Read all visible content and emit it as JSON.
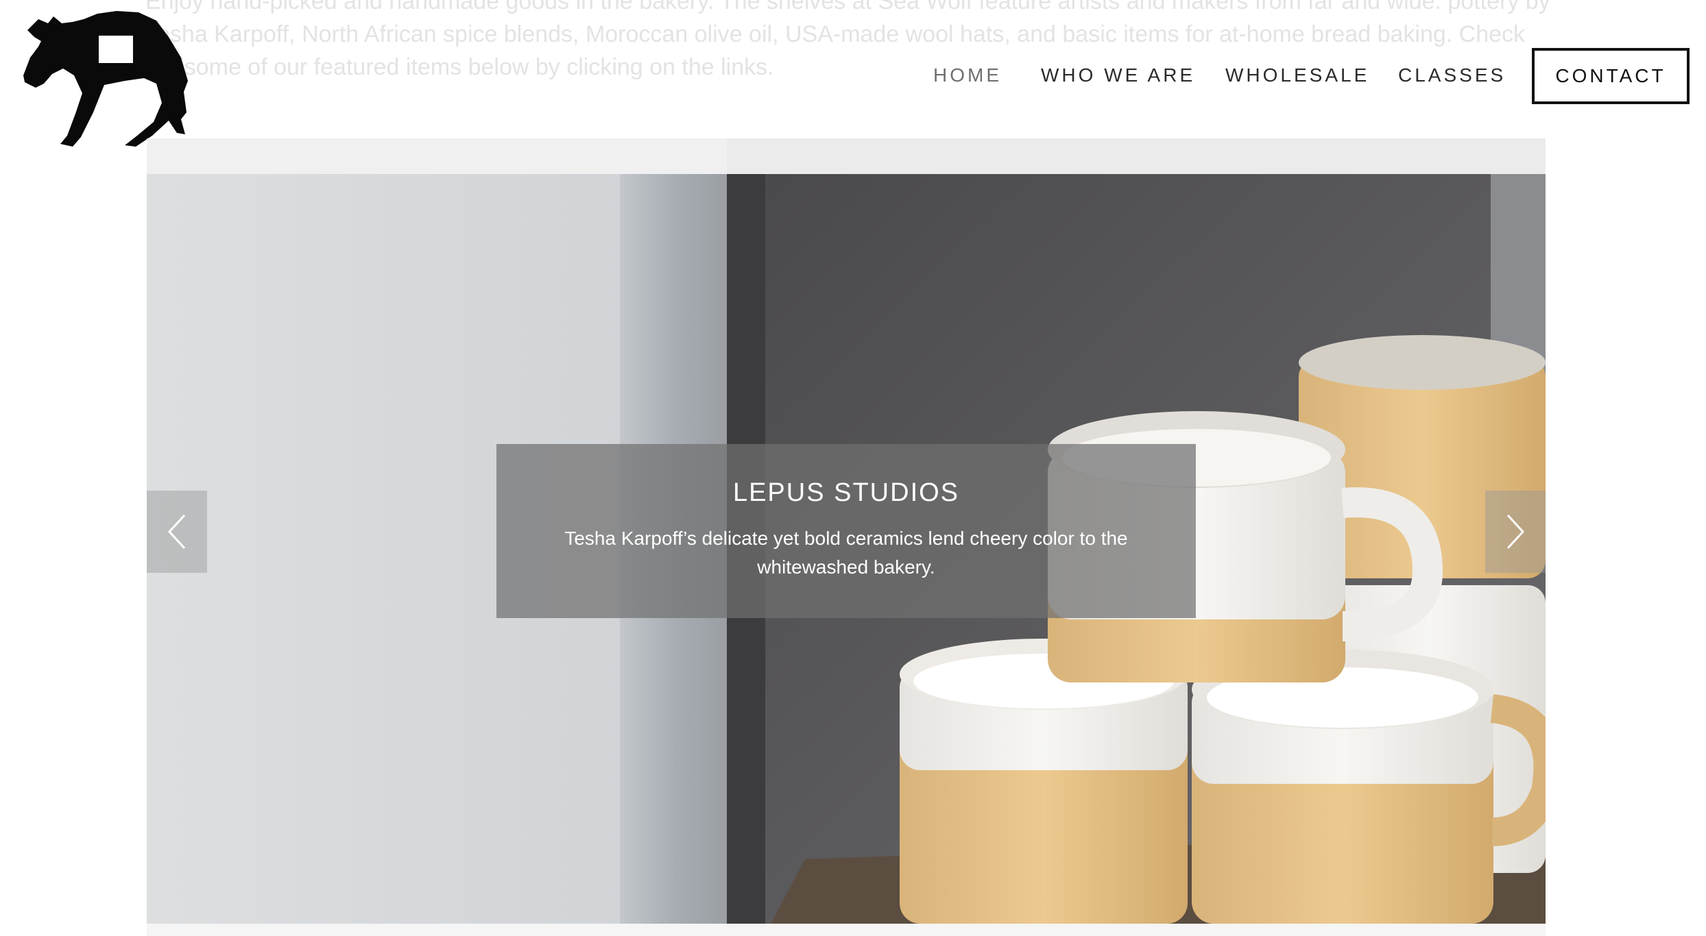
{
  "intro": {
    "text": "Enjoy hand-picked and handmade goods in the bakery. The shelves at Sea Wolf feature artists and makers from far and wide: pottery by Tesha Karpoff, North African spice blends, Moroccan olive oil, USA-made wool hats, and basic items for at-home bread baking. Check out some of our featured items below by clicking on the links."
  },
  "logo": {
    "icon": "wolf-silhouette-icon"
  },
  "nav": {
    "items": [
      {
        "label": "HOME",
        "active": true
      },
      {
        "label": "WHO WE ARE"
      },
      {
        "label": "WHOLESALE"
      },
      {
        "label": "CLASSES"
      }
    ],
    "contact_label": "CONTACT"
  },
  "slider": {
    "title": "LEPUS STUDIOS",
    "text": "Tesha Karpoff’s delicate yet bold ceramics lend cheery color to the whitewashed bakery.",
    "prev_icon": "chevron-left-icon",
    "next_icon": "chevron-right-icon"
  },
  "colors": {
    "caption_bg": "#707070",
    "ceramic_glaze": "#e2c088",
    "ceramic_white": "#f2f0ec"
  }
}
